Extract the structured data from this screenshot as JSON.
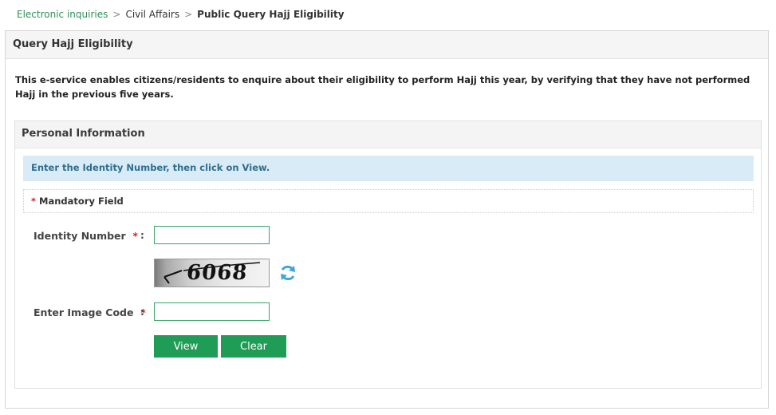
{
  "breadcrumb": {
    "items": [
      "Electronic inquiries",
      "Civil Affairs"
    ],
    "current": "Public Query Hajj Eligibility",
    "separator": ">"
  },
  "page": {
    "title": "Query Hajj Eligibility",
    "description": "This e-service enables citizens/residents to enquire about their eligibility to perform Hajj this year, by verifying that they have not performed Hajj in the previous five years."
  },
  "section": {
    "title": "Personal Information",
    "info": "Enter the Identity Number, then click on View.",
    "mandatory_star": "*",
    "mandatory_text": "Mandatory Field"
  },
  "form": {
    "identity_label": "Identity Number",
    "identity_value": "",
    "required_star": "*",
    "colon": ":",
    "captcha_text": "6068",
    "captcha_refresh_icon": "refresh-icon",
    "image_code_label": "Enter Image Code",
    "image_code_value": ""
  },
  "buttons": {
    "view": "View",
    "clear": "Clear"
  },
  "colors": {
    "accent_green": "#1f9c55",
    "link_green": "#2e8f59",
    "info_bg": "#d9ebf6",
    "info_text": "#2e6d8e",
    "required_red": "#d9251c",
    "refresh_blue": "#3fa6dc"
  }
}
